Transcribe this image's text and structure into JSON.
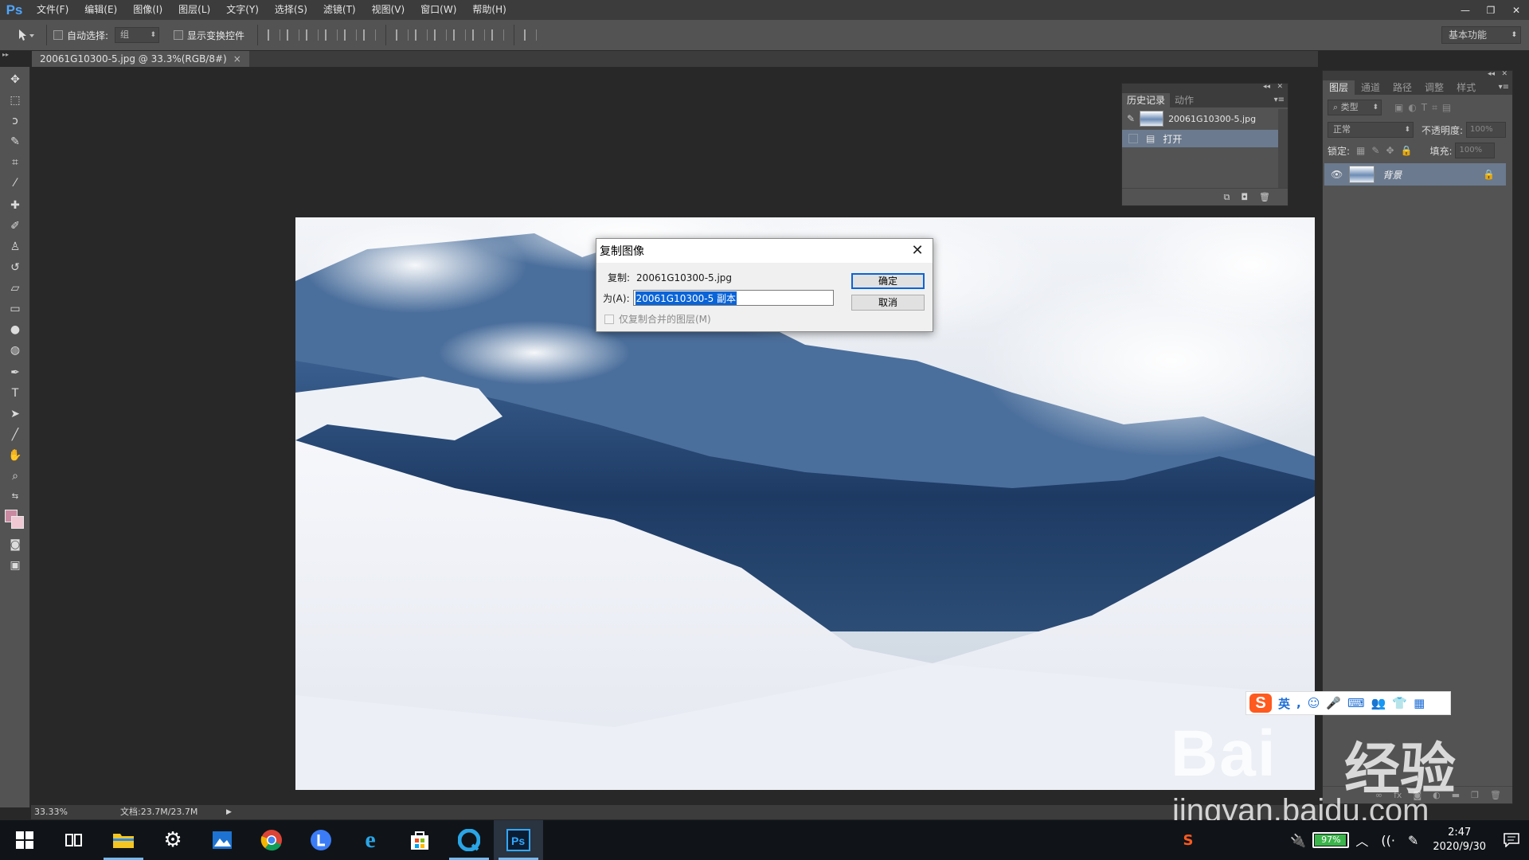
{
  "app": {
    "logo": "Ps",
    "menu": [
      "文件(F)",
      "编辑(E)",
      "图像(I)",
      "图层(L)",
      "文字(Y)",
      "选择(S)",
      "滤镜(T)",
      "视图(V)",
      "窗口(W)",
      "帮助(H)"
    ],
    "window_controls": {
      "minimize": "—",
      "restore": "❐",
      "close": "✕"
    }
  },
  "options_bar": {
    "tool_icon": "move-tool-icon",
    "auto_select_label": "自动选择:",
    "auto_select_checked": false,
    "auto_select_value": "组",
    "show_transform_label": "显示变换控件",
    "show_transform_checked": false,
    "workspace": "基本功能"
  },
  "document": {
    "tab_title": "20061G10300-5.jpg @ 33.3%(RGB/8#)",
    "tab_close": "×"
  },
  "status_bar": {
    "zoom": "33.33%",
    "doc_size": "文档:23.7M/23.7M"
  },
  "colors": {
    "foreground": "#c98aa1",
    "background": "#f0c8d4",
    "selection_blue": "#0a64d8",
    "panel_gray": "#535353",
    "highlight_row": "#6b7a8e"
  },
  "history_panel": {
    "tabs": [
      "历史记录",
      "动作"
    ],
    "active_tab": 0,
    "snapshot_name": "20061G10300-5.jpg",
    "steps": [
      {
        "label": "打开",
        "icon": "open-document-icon"
      }
    ]
  },
  "layers_panel": {
    "tabs": [
      "图层",
      "通道",
      "路径",
      "调整",
      "样式"
    ],
    "active_tab": 0,
    "filter_kind": "类型",
    "blend_mode": "正常",
    "opacity_label": "不透明度:",
    "opacity_value": "100%",
    "lock_label": "锁定:",
    "fill_label": "填充:",
    "fill_value": "100%",
    "layers": [
      {
        "name": "背景",
        "visible": true,
        "locked": true
      }
    ]
  },
  "dialog": {
    "title": "复制图像",
    "source_label": "复制:",
    "source_name": "20061G10300-5.jpg",
    "as_label": "为(A):",
    "as_value": "20061G10300-5 副本",
    "ok_label": "确定",
    "cancel_label": "取消",
    "merged_only_label": "仅复制合并的图层(M)",
    "merged_only_checked": false
  },
  "ime_bar": {
    "logo": "S",
    "mode": "英",
    "items": [
      ",",
      "☺",
      "🎤",
      "⌨",
      "👥",
      "👕",
      "▦"
    ]
  },
  "watermark": {
    "brand": "Bai",
    "brand_cn": "经验",
    "url": "jingyan.baidu.com"
  },
  "taskbar": {
    "apps": [
      "start",
      "task-view",
      "file-explorer",
      "settings",
      "photos",
      "chrome",
      "lark",
      "ie",
      "store",
      "qq-browser",
      "photoshop"
    ],
    "active_app": "photoshop",
    "battery_percent": "97%",
    "time": "2:47",
    "date": "2020/9/30"
  }
}
